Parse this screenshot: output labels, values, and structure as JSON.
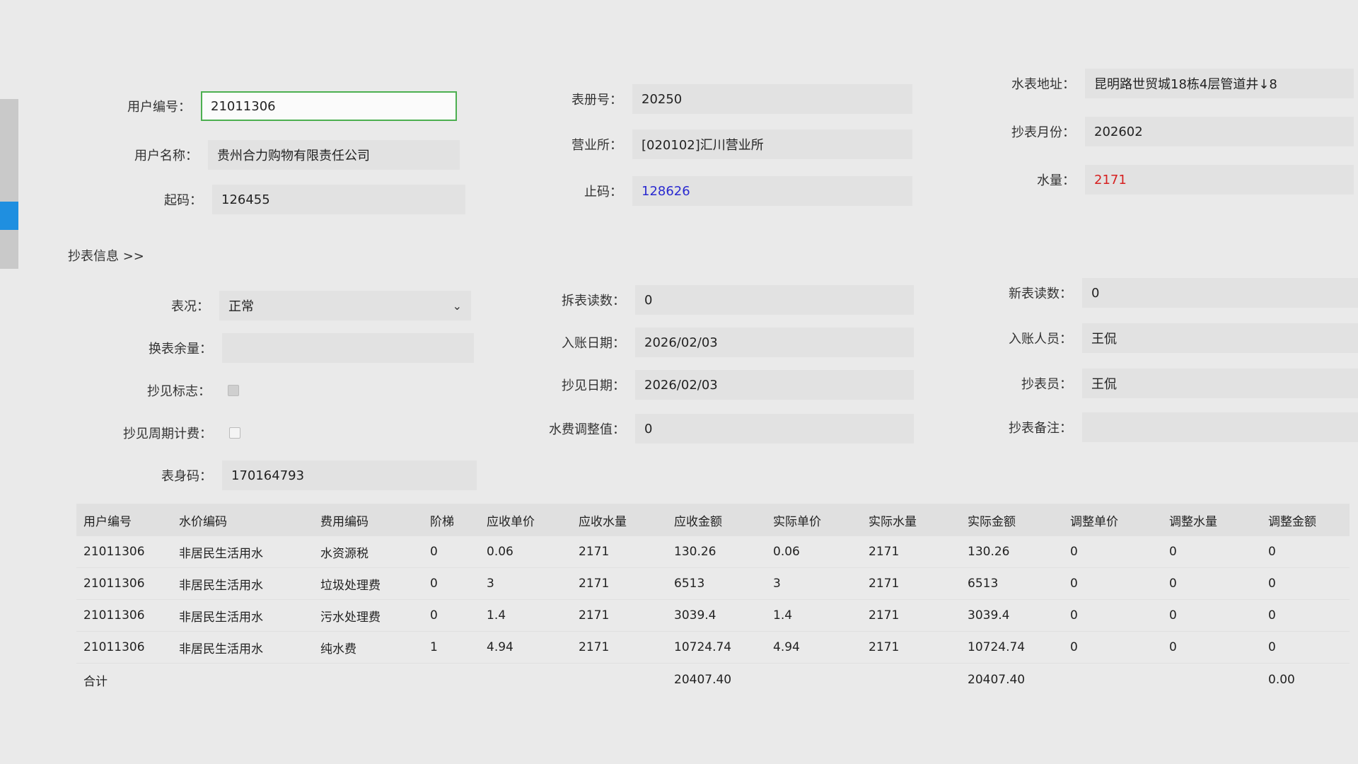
{
  "form": {
    "user_no": {
      "label": "用户编号：",
      "value": "21011306"
    },
    "user_name": {
      "label": "用户名称：",
      "value": "贵州合力购物有限责任公司"
    },
    "start_code": {
      "label": "起码：",
      "value": "126455"
    },
    "book_no": {
      "label": "表册号：",
      "value": "20250"
    },
    "office": {
      "label": "营业所：",
      "value": "[020102]汇川营业所"
    },
    "end_code": {
      "label": "止码：",
      "value": "128626"
    },
    "meter_address": {
      "label": "水表地址：",
      "value": "昆明路世贸城18栋4层管道井↓8"
    },
    "read_month": {
      "label": "抄表月份：",
      "value": "202602"
    },
    "water_qty": {
      "label": "水量：",
      "value": "2171"
    }
  },
  "reading_section": {
    "title": "抄表信息  >>"
  },
  "reading": {
    "meter_status": {
      "label": "表况：",
      "value": "正常"
    },
    "swap_remain": {
      "label": "换表余量：",
      "value": ""
    },
    "seen_flag": {
      "label": "抄见标志：",
      "checked": true
    },
    "seen_cycle": {
      "label": "抄见周期计费：",
      "checked": false
    },
    "meter_body_code": {
      "label": "表身码：",
      "value": "170164793"
    },
    "removed_reading": {
      "label": "拆表读数：",
      "value": "0"
    },
    "post_date": {
      "label": "入账日期：",
      "value": "2026/02/03"
    },
    "seen_date": {
      "label": "抄见日期：",
      "value": "2026/02/03"
    },
    "fee_adjust": {
      "label": "水费调整值：",
      "value": "0"
    },
    "new_reading": {
      "label": "新表读数：",
      "value": "0"
    },
    "post_person": {
      "label": "入账人员：",
      "value": "王侃"
    },
    "reader": {
      "label": "抄表员：",
      "value": "王侃"
    },
    "remark": {
      "label": "抄表备注：",
      "value": ""
    }
  },
  "table": {
    "headers": [
      "用户编号",
      "水价编码",
      "费用编码",
      "阶梯",
      "应收单价",
      "应收水量",
      "应收金额",
      "实际单价",
      "实际水量",
      "实际金额",
      "调整单价",
      "调整水量",
      "调整金额"
    ],
    "rows": [
      [
        "21011306",
        "非居民生活用水",
        "水资源税",
        "0",
        "0.06",
        "2171",
        "130.26",
        "0.06",
        "2171",
        "130.26",
        "0",
        "0",
        "0"
      ],
      [
        "21011306",
        "非居民生活用水",
        "垃圾处理费",
        "0",
        "3",
        "2171",
        "6513",
        "3",
        "2171",
        "6513",
        "0",
        "0",
        "0"
      ],
      [
        "21011306",
        "非居民生活用水",
        "污水处理费",
        "0",
        "1.4",
        "2171",
        "3039.4",
        "1.4",
        "2171",
        "3039.4",
        "0",
        "0",
        "0"
      ],
      [
        "21011306",
        "非居民生活用水",
        "纯水费",
        "1",
        "4.94",
        "2171",
        "10724.74",
        "4.94",
        "2171",
        "10724.74",
        "0",
        "0",
        "0"
      ]
    ],
    "total": {
      "label": "合计",
      "receivable_amount": "20407.40",
      "actual_amount": "20407.40",
      "adjust_amount": "0.00"
    }
  },
  "colors": {
    "accent_input_border": "#4caf50",
    "end_code_color": "#2a2ad0",
    "water_qty_color": "#d62020"
  }
}
